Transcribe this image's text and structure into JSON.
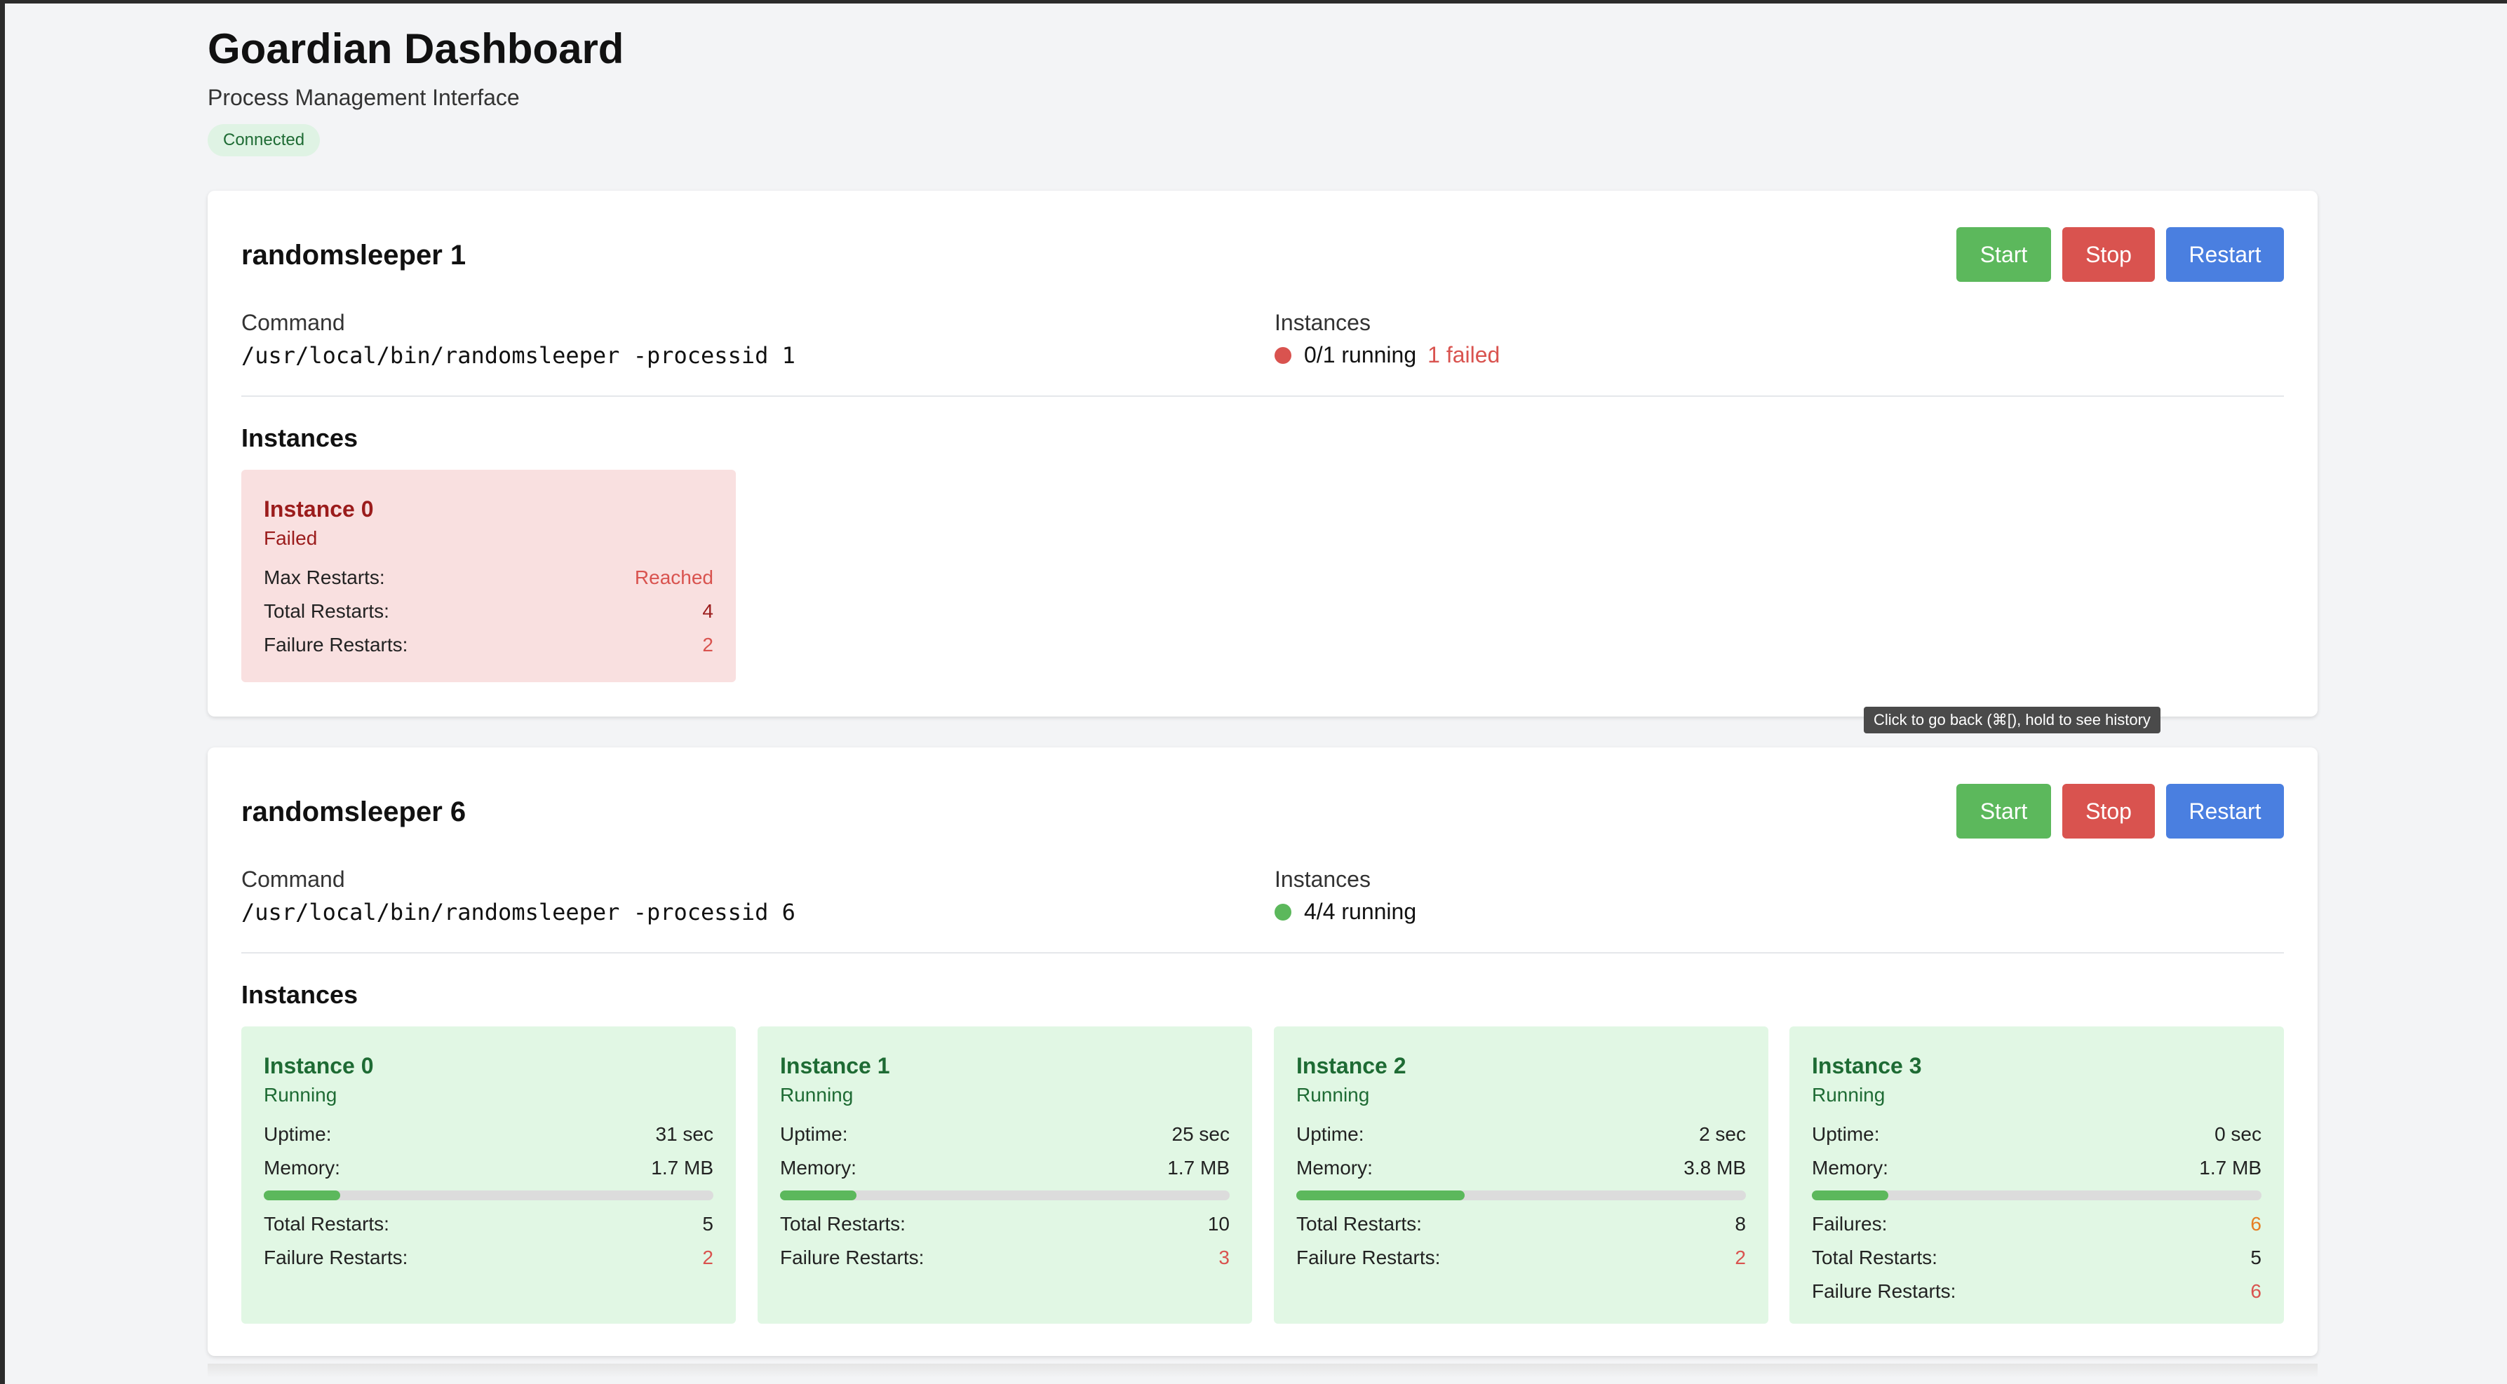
{
  "header": {
    "title": "Goardian Dashboard",
    "subtitle": "Process Management Interface",
    "connection_status": "Connected"
  },
  "buttons": {
    "start": "Start",
    "stop": "Stop",
    "restart": "Restart"
  },
  "labels": {
    "command": "Command",
    "instances_col": "Instances",
    "instances_section": "Instances",
    "max_restarts": "Max Restarts:",
    "total_restarts": "Total Restarts:",
    "failure_restarts": "Failure Restarts:",
    "uptime": "Uptime:",
    "memory": "Memory:",
    "failures": "Failures:"
  },
  "processes": [
    {
      "name": "randomsleeper 1",
      "command": "/usr/local/bin/randomsleeper -processid 1",
      "running_summary": "0/1 running",
      "failed_summary": "1 failed",
      "status_color": "#d9534f",
      "instances": [
        {
          "title": "Instance 0",
          "state": "Failed",
          "max_restarts": "Reached",
          "total_restarts": "4",
          "failure_restarts": "2"
        }
      ]
    },
    {
      "name": "randomsleeper 6",
      "command": "/usr/local/bin/randomsleeper -processid 6",
      "running_summary": "4/4 running",
      "status_color": "#5cb85c",
      "instances": [
        {
          "title": "Instance 0",
          "state": "Running",
          "uptime": "31 sec",
          "memory": "1.7 MB",
          "memory_fraction": 0.17,
          "total_restarts": "5",
          "failure_restarts": "2"
        },
        {
          "title": "Instance 1",
          "state": "Running",
          "uptime": "25 sec",
          "memory": "1.7 MB",
          "memory_fraction": 0.17,
          "total_restarts": "10",
          "failure_restarts": "3"
        },
        {
          "title": "Instance 2",
          "state": "Running",
          "uptime": "2 sec",
          "memory": "3.8 MB",
          "memory_fraction": 0.375,
          "total_restarts": "8",
          "failure_restarts": "2"
        },
        {
          "title": "Instance 3",
          "state": "Running",
          "uptime": "0 sec",
          "memory": "1.7 MB",
          "memory_fraction": 0.17,
          "failures": "6",
          "total_restarts": "5",
          "failure_restarts": "6"
        }
      ]
    }
  ],
  "tooltip": "Click to go back (⌘[), hold to see history"
}
